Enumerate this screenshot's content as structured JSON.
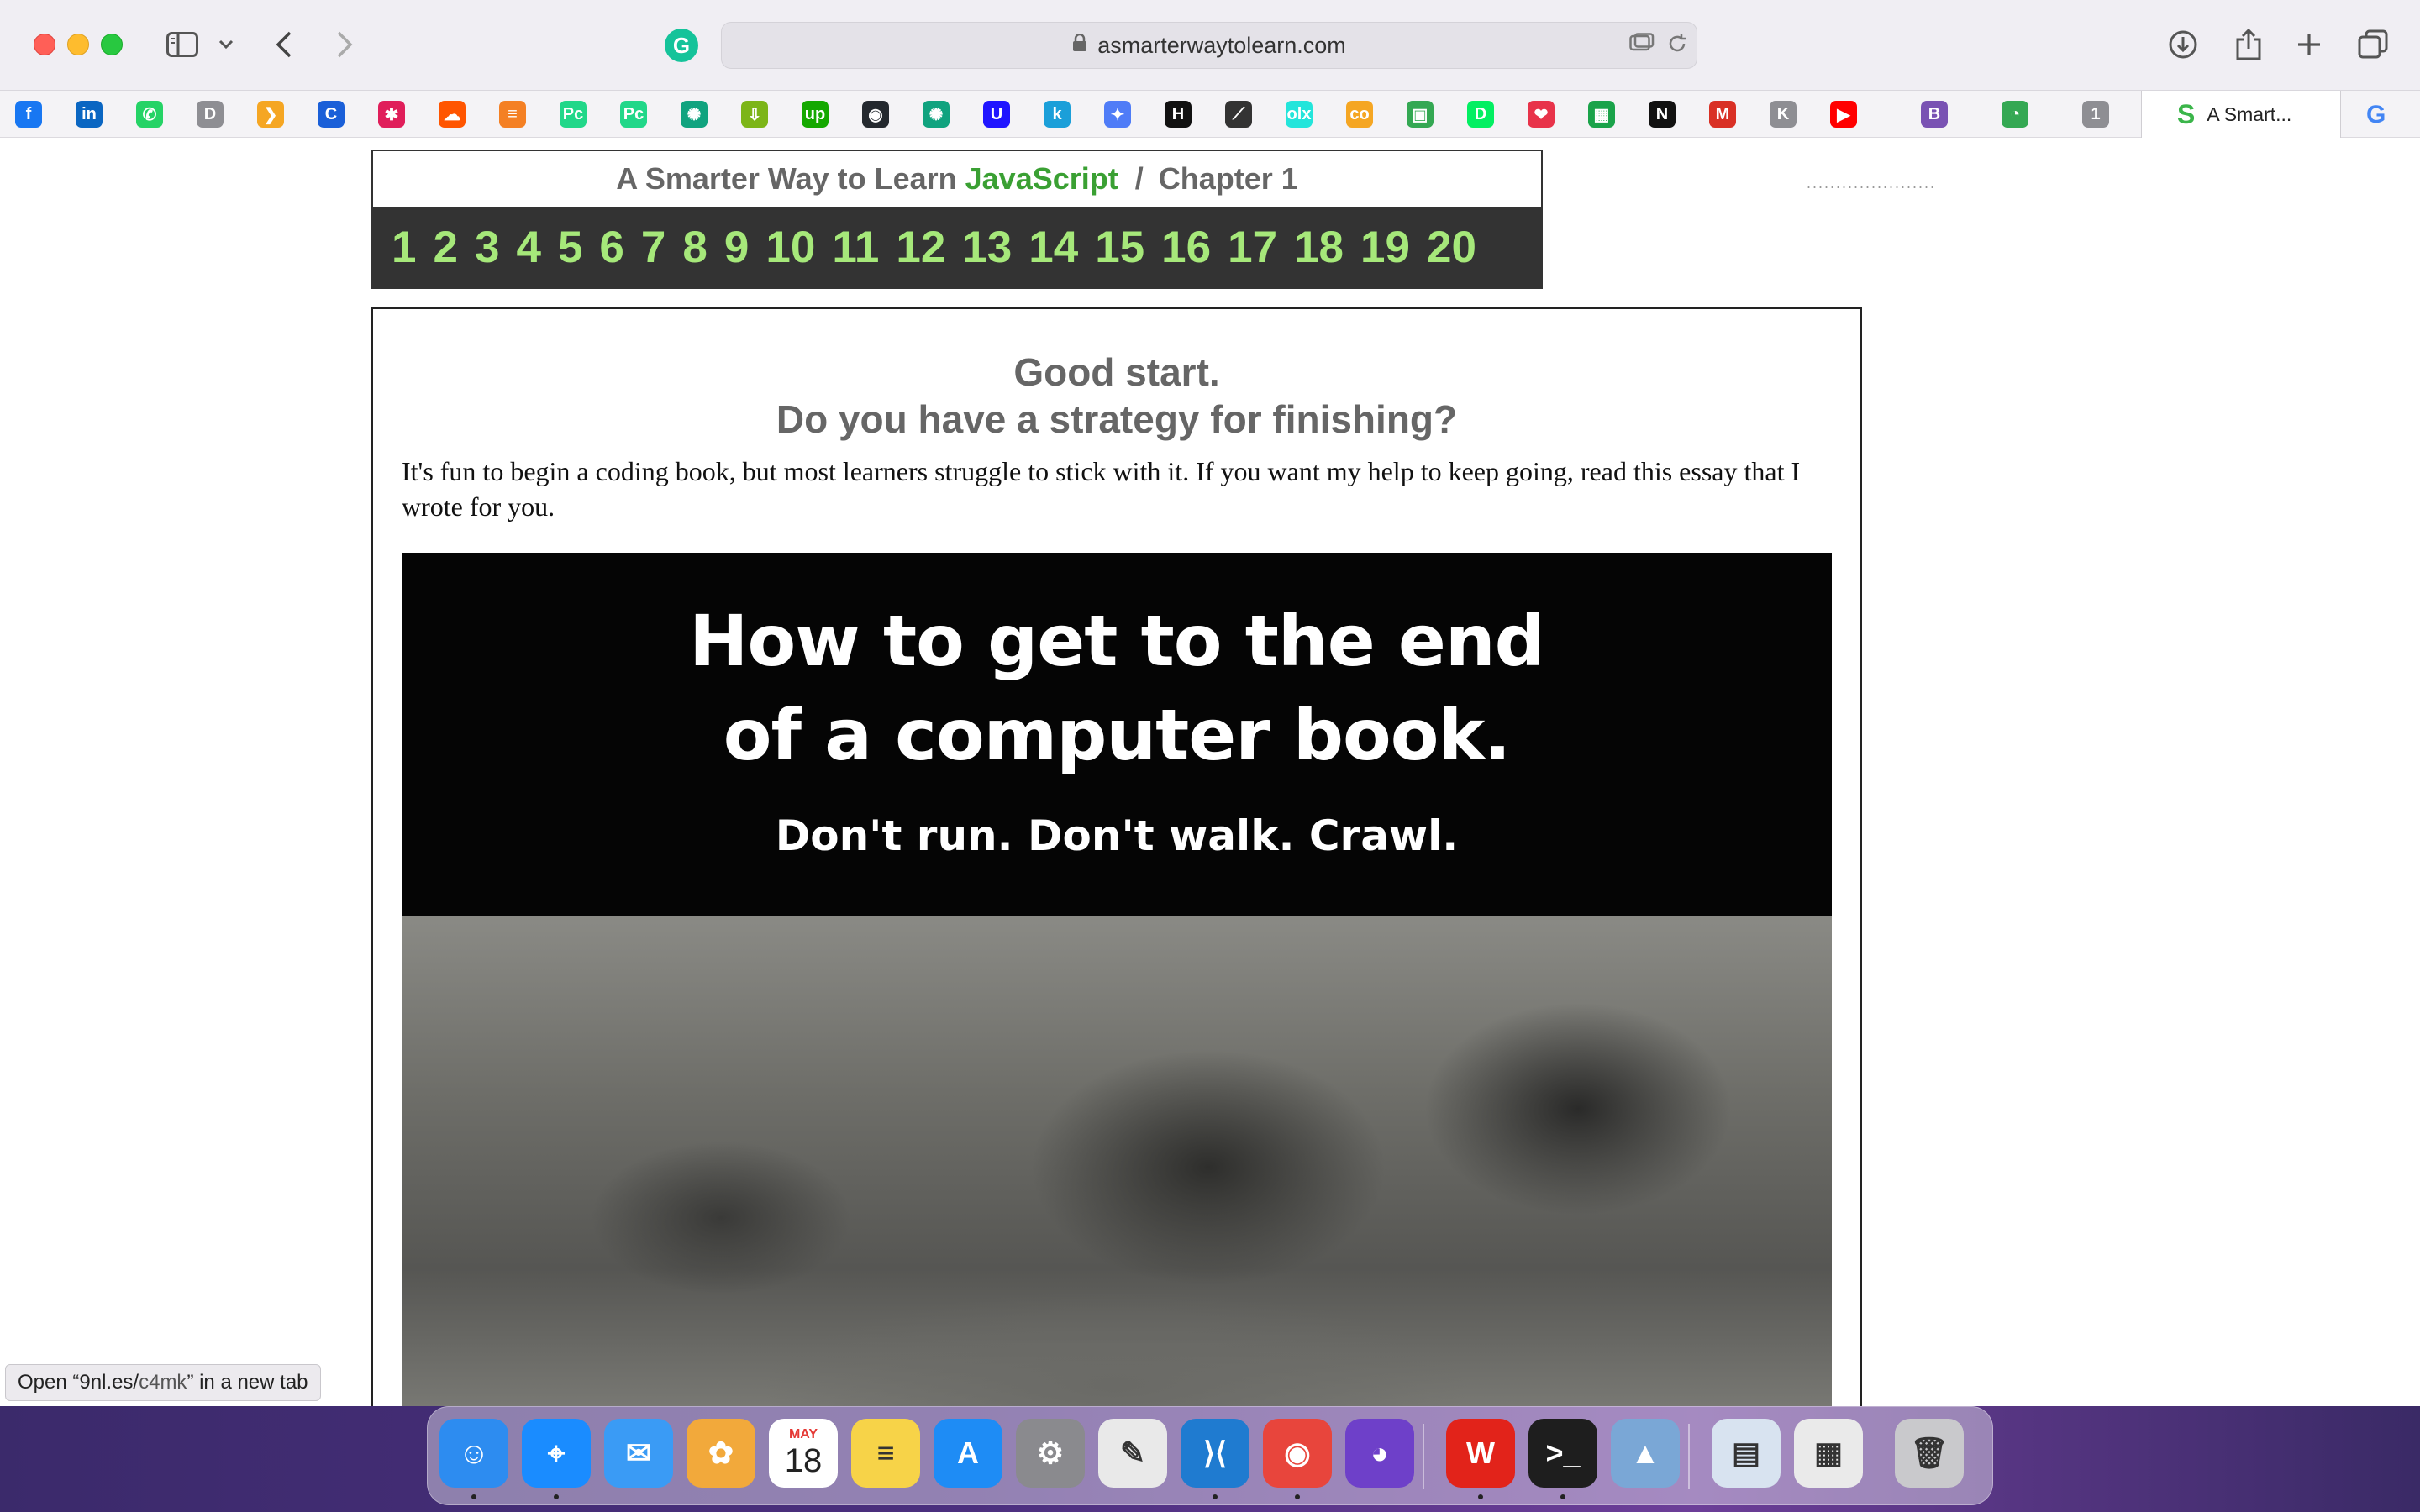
{
  "browser": {
    "url": "asmarterwaytolearn.com",
    "active_tab_label": "A Smart...",
    "grammarly_glyph": "G",
    "s_glyph": "S",
    "g_glyph": "G"
  },
  "favorites": [
    {
      "icon": "facebook-icon",
      "glyph": "f",
      "color": "#1877f2"
    },
    {
      "icon": "linkedin-icon",
      "glyph": "in",
      "color": "#0a66c2"
    },
    {
      "icon": "whatsapp-icon",
      "glyph": "✆",
      "color": "#25d366"
    },
    {
      "icon": "d-icon",
      "glyph": "D",
      "color": "#8e8e93"
    },
    {
      "icon": "orange-bookmark-icon",
      "glyph": "❯",
      "color": "#f5a623"
    },
    {
      "icon": "c-icon",
      "glyph": "C",
      "color": "#1a5fd8"
    },
    {
      "icon": "slack-icon",
      "glyph": "✱",
      "color": "#e01e5a"
    },
    {
      "icon": "soundcloud-icon",
      "glyph": "☁",
      "color": "#ff5500"
    },
    {
      "icon": "stackoverflow-icon",
      "glyph": "≡",
      "color": "#f48024"
    },
    {
      "icon": "pycharm-icon",
      "glyph": "Pc",
      "color": "#21d789"
    },
    {
      "icon": "pycharm-alt-icon",
      "glyph": "Pc",
      "color": "#21d789"
    },
    {
      "icon": "chatgpt-icon",
      "glyph": "✺",
      "color": "#10a37f"
    },
    {
      "icon": "download-icon",
      "glyph": "⇩",
      "color": "#7cb518"
    },
    {
      "icon": "upwork-icon",
      "glyph": "up",
      "color": "#14a800"
    },
    {
      "icon": "github-icon",
      "glyph": "◉",
      "color": "#24292f"
    },
    {
      "icon": "openai-icon",
      "glyph": "✺",
      "color": "#10a37f"
    },
    {
      "icon": "udacity-icon",
      "glyph": "U",
      "color": "#2015ff"
    },
    {
      "icon": "k-icon",
      "glyph": "k",
      "color": "#1b9fd9"
    },
    {
      "icon": "gemini-icon",
      "glyph": "✦",
      "color": "#4f7cf7"
    },
    {
      "icon": "hackerrank-icon",
      "glyph": "H",
      "color": "#111111"
    },
    {
      "icon": "codewars-icon",
      "glyph": "⟋",
      "color": "#333333"
    },
    {
      "icon": "olx-icon",
      "glyph": "olx",
      "color": "#23e5db"
    },
    {
      "icon": "coursera-icon",
      "glyph": "co",
      "color": "#f5a623"
    },
    {
      "icon": "classroom-icon",
      "glyph": "▣",
      "color": "#34a853"
    },
    {
      "icon": "datacamp-icon",
      "glyph": "D",
      "color": "#03ef62"
    },
    {
      "icon": "heart-icon",
      "glyph": "❤",
      "color": "#e8334a"
    },
    {
      "icon": "green-grid-icon",
      "glyph": "▦",
      "color": "#1aa34a"
    },
    {
      "icon": "notion-icon",
      "glyph": "N",
      "color": "#111111"
    },
    {
      "icon": "gmail-icon",
      "glyph": "M",
      "color": "#d93025"
    },
    {
      "icon": "k-grey-icon",
      "glyph": "K",
      "color": "#8e8e93"
    },
    {
      "icon": "youtube-icon",
      "glyph": "▶",
      "color": "#ff0000"
    },
    {
      "icon": "bootstrap-icon",
      "glyph": "B",
      "color": "#7952b3"
    },
    {
      "icon": "drive-icon",
      "glyph": "◔",
      "color": "#34a853"
    },
    {
      "icon": "one-icon",
      "glyph": "1",
      "color": "#8e8e93"
    }
  ],
  "chapter_header": {
    "prefix": "A Smarter Way to Learn",
    "language": "JavaScript",
    "separator": "/",
    "chapter": "Chapter 1",
    "numbers": [
      "1",
      "2",
      "3",
      "4",
      "5",
      "6",
      "7",
      "8",
      "9",
      "10",
      "11",
      "12",
      "13",
      "14",
      "15",
      "16",
      "17",
      "18",
      "19",
      "20"
    ],
    "dots": "......................"
  },
  "content": {
    "heading_line1": "Good start.",
    "heading_line2": "Do you have a strategy for finishing?",
    "intro_text": "It's fun to begin a coding book, but most learners struggle to stick with it. If you want my help to keep going, read this essay that I wrote for you."
  },
  "banner": {
    "line1": "How to get to the end",
    "line2": "of a computer book.",
    "line3": "Don't run. Don't walk. Crawl."
  },
  "status_link": {
    "prefix": "Open “9nl.es/",
    "path": "c4mk",
    "suffix": "” in a new tab"
  },
  "dock": {
    "calendar_month": "MAY",
    "calendar_day": "18",
    "apps": [
      {
        "icon": "finder-icon",
        "glyph": "☺",
        "color": "#2d8cf0"
      },
      {
        "icon": "safari-icon",
        "glyph": "⌖",
        "color": "#1a8cff"
      },
      {
        "icon": "mail-icon",
        "glyph": "✉",
        "color": "#3a9bf5"
      },
      {
        "icon": "photos-icon",
        "glyph": "✿",
        "color": "#f2a93b"
      },
      {
        "icon": "calendar-icon",
        "glyph": "",
        "color": "#ffffff"
      },
      {
        "icon": "notes-icon",
        "glyph": "≡",
        "color": "#f7d348"
      },
      {
        "icon": "app-store-icon",
        "glyph": "A",
        "color": "#1e8cf5"
      },
      {
        "icon": "system-settings-icon",
        "glyph": "⚙",
        "color": "#8a8a8e"
      },
      {
        "icon": "textedit-icon",
        "glyph": "✎",
        "color": "#e9e9e9"
      },
      {
        "icon": "vscode-icon",
        "glyph": "⟩⟨",
        "color": "#1f7bd0"
      },
      {
        "icon": "chrome-icon",
        "glyph": "◉",
        "color": "#e8453c"
      },
      {
        "icon": "github-desktop-icon",
        "glyph": "◕",
        "color": "#6e40c9"
      },
      {
        "icon": "wps-office-icon",
        "glyph": "W",
        "color": "#e2231a"
      },
      {
        "icon": "terminal-icon",
        "glyph": ">_",
        "color": "#1e1e1e"
      },
      {
        "icon": "preview-icon",
        "glyph": "▲",
        "color": "#7aa7d6"
      },
      {
        "icon": "downloads-stack-icon",
        "glyph": "▤",
        "color": "#d8e3f0"
      },
      {
        "icon": "documents-stack-icon",
        "glyph": "▦",
        "color": "#eaeaea"
      },
      {
        "icon": "trash-icon",
        "glyph": "🗑",
        "color": "#c9c9cc"
      }
    ]
  }
}
